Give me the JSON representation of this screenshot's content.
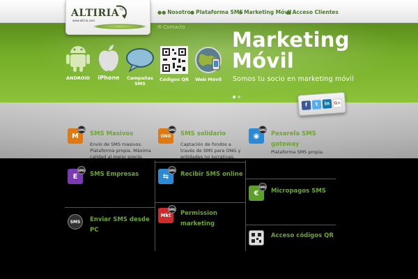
{
  "header": {
    "logo_text": "ALTIRIA",
    "logo_tm": "TIC",
    "logo_url": "www.altiria.com",
    "nav": [
      {
        "label": "Nosotros",
        "icon": "people-icon"
      },
      {
        "label": "Plataforma SMS",
        "icon": "chat-icon"
      },
      {
        "label": "Marketing Móvil",
        "icon": "globe-icon"
      },
      {
        "label": "Acceso Clientes",
        "icon": "lock-icon"
      }
    ],
    "contacto": "Contacto"
  },
  "banner": {
    "title_line1": "Marketing",
    "title_line2": "Móvil",
    "subtitle": "Somos tu socio en marketing móvil",
    "icons": [
      {
        "label": "ANDROID",
        "icon": "android-icon"
      },
      {
        "label": "iPhone",
        "icon": "apple-icon"
      },
      {
        "label": "Campañas SMS",
        "icon": "speech-bubble-icon"
      },
      {
        "label": "Códigos QR",
        "icon": "qr-code-icon"
      },
      {
        "label": "Web Móvil",
        "icon": "world-mobile-icon"
      }
    ],
    "slide_count": 2,
    "active_slide": 1
  },
  "social": [
    {
      "label": "f",
      "name": "facebook",
      "color": "#3b5998"
    },
    {
      "label": "t",
      "name": "twitter",
      "color": "#55acee"
    },
    {
      "label": "in",
      "name": "linkedin",
      "color": "#0e76a8"
    },
    {
      "label": "G+",
      "name": "google-plus",
      "color": "#dd4b39"
    }
  ],
  "services": [
    {
      "title": "SMS Masivos",
      "desc": "Envío de SMS masivos. Plataforma propia. Máxima calidad al mejor precio.",
      "icon_text": "M",
      "color": "#e07a10"
    },
    {
      "title": "SMS solidario",
      "desc": "Captación de fondos a través de SMS para ONG y entidades no lucrativas.",
      "icon_text": "ONG",
      "color": "#e07a10"
    },
    {
      "title": "Pasarela SMS gateway",
      "desc": "Plataforma SMS propia.",
      "icon_text": "",
      "color": "#2a8ad4"
    },
    {
      "title": "SMS Empresas",
      "desc": "",
      "icon_text": "E",
      "color": "#7a3ab4"
    },
    {
      "title": "Recibir SMS online",
      "desc": "",
      "icon_text": "",
      "color": "#2a8ad4"
    },
    {
      "title": "Micropagos SMS",
      "desc": "",
      "icon_text": "€",
      "color": "#5aa02a"
    },
    {
      "title": "Enviar SMS desde PC",
      "desc": "",
      "icon_text": "SMS",
      "color": "#333333"
    },
    {
      "title": "Permission marketing",
      "desc": "",
      "icon_text": "Mkt",
      "color": "#d02a2a"
    },
    {
      "title": "Acceso códigos QR",
      "desc": "",
      "icon_text": "",
      "color": "#dddddd"
    }
  ],
  "colors": {
    "accent": "#6ea534",
    "banner": "#74ad27",
    "nav": "#4a7a2a"
  }
}
